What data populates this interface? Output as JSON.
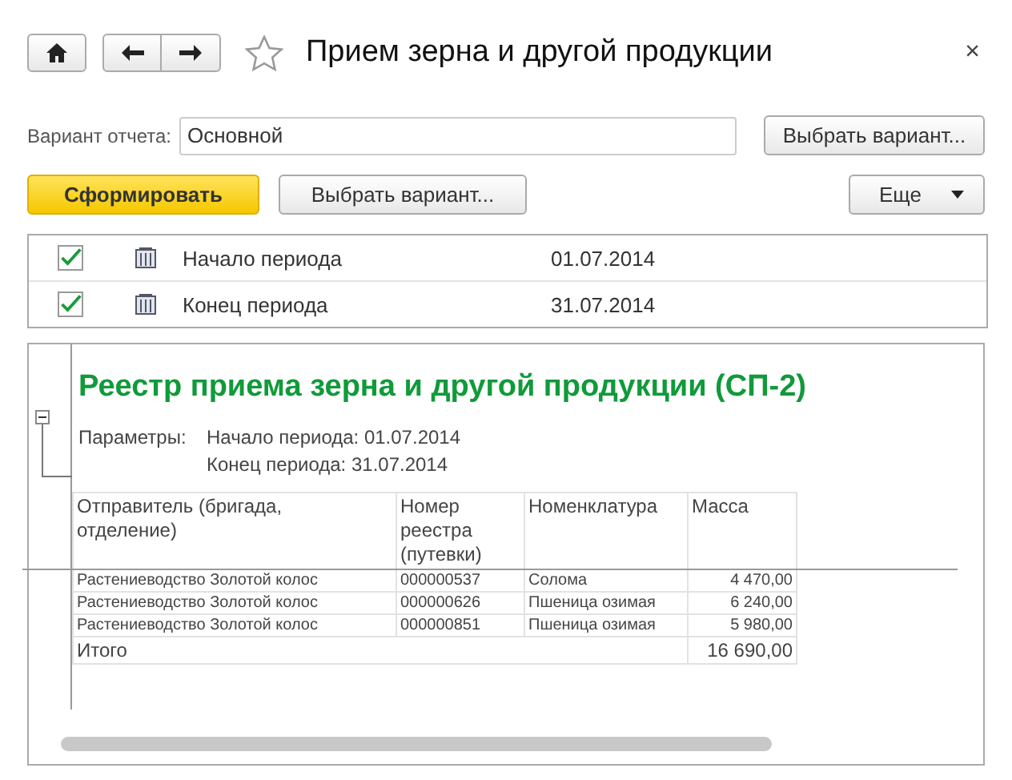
{
  "window": {
    "title": "Прием зерна и другой продукции",
    "close": "×"
  },
  "variant": {
    "label": "Вариант отчета:",
    "value": "Основной",
    "button": "Выбрать вариант..."
  },
  "toolbar": {
    "generate": "Сформировать",
    "choose": "Выбрать вариант...",
    "more": "Еще"
  },
  "settings": [
    {
      "checked": true,
      "label": "Начало периода",
      "value": "01.07.2014"
    },
    {
      "checked": true,
      "label": "Конец периода",
      "value": "31.07.2014"
    }
  ],
  "report": {
    "title": "Реестр приема зерна и другой продукции (СП-2)",
    "expanded": true,
    "params_label": "Параметры:",
    "params": [
      "Начало периода: 01.07.2014",
      "Конец периода: 31.07.2014"
    ],
    "columns": [
      "Отправитель (бригада, отделение)",
      "Номер реестра (путевки)",
      "Номенклатура",
      "Масса"
    ],
    "rows": [
      [
        "Растениеводство Золотой колос",
        "000000537",
        "Солома",
        "4 470,00"
      ],
      [
        "Растениеводство Золотой колос",
        "000000626",
        "Пшеница озимая",
        "6 240,00"
      ],
      [
        "Растениеводство Золотой колос",
        "000000851",
        "Пшеница озимая",
        "5 980,00"
      ]
    ],
    "total": {
      "label": "Итого",
      "value": "16 690,00"
    }
  }
}
